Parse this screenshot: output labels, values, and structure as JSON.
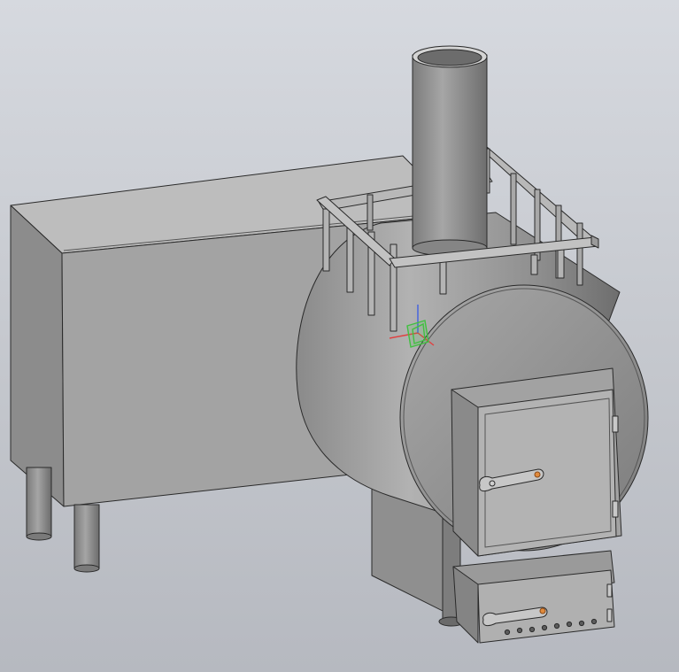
{
  "viewport": {
    "view_mode": "shaded-with-edges",
    "background_top": "#d6d9df",
    "background_bottom": "#b6b9c0"
  },
  "model": {
    "parts": [
      "water-tank",
      "tank-legs",
      "firebox-barrel",
      "chimney-pipe",
      "stone-rack",
      "firebox-door",
      "ash-pit-drawer"
    ],
    "colors": {
      "body": "#9c9c9c",
      "edge": "#2a2a2a",
      "handle_accent": "#e08a3c"
    }
  },
  "triad": {
    "axes": [
      "x",
      "y",
      "z"
    ],
    "colors": {
      "x": "#e04040",
      "y": "#40c040",
      "z": "#4060e0"
    }
  }
}
